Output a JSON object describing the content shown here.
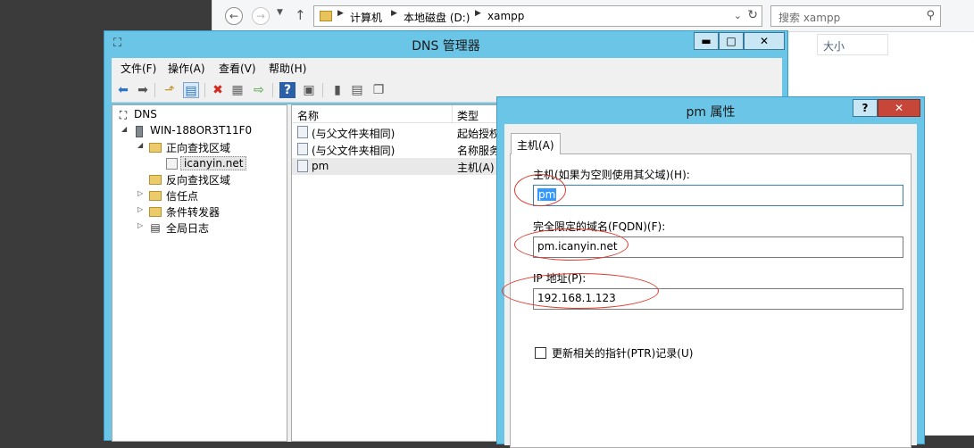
{
  "explorer": {
    "breadcrumbs": [
      "计算机",
      "本地磁盘 (D:)",
      "xampp"
    ],
    "search_placeholder": "搜索 xampp",
    "column_size": "大小"
  },
  "dns_manager": {
    "title": "DNS 管理器",
    "menu": [
      "文件(F)",
      "操作(A)",
      "查看(V)",
      "帮助(H)"
    ],
    "tree": {
      "root": "DNS",
      "server": "WIN-188OR3T11F0",
      "forward_zones": "正向查找区域",
      "zone": "icanyin.net",
      "reverse_zones": "反向查找区域",
      "trust_points": "信任点",
      "conditional_forwarders": "条件转发器",
      "global_logs": "全局日志"
    },
    "list": {
      "columns": {
        "name": "名称",
        "type": "类型"
      },
      "rows": [
        {
          "name": "(与父文件夹相同)",
          "type": "起始授权"
        },
        {
          "name": "(与父文件夹相同)",
          "type": "名称服务"
        },
        {
          "name": "pm",
          "type": "主机(A)"
        }
      ]
    }
  },
  "properties_dialog": {
    "title": "pm 属性",
    "help": "?",
    "tab": "主机(A)",
    "host_label": "主机(如果为空则使用其父域)(H):",
    "host_value": "pm",
    "fqdn_label": "完全限定的域名(FQDN)(F):",
    "fqdn_value": "pm.icanyin.net",
    "ip_label": "IP 地址(P):",
    "ip_value": "192.168.1.123",
    "ptr_label": "更新相关的指针(PTR)记录(U)",
    "ptr_checked": false
  },
  "colors": {
    "window_frame": "#6bc5e7",
    "close_button": "#c7463a",
    "annotation": "#e03a2e",
    "selection": "#3399ff"
  }
}
